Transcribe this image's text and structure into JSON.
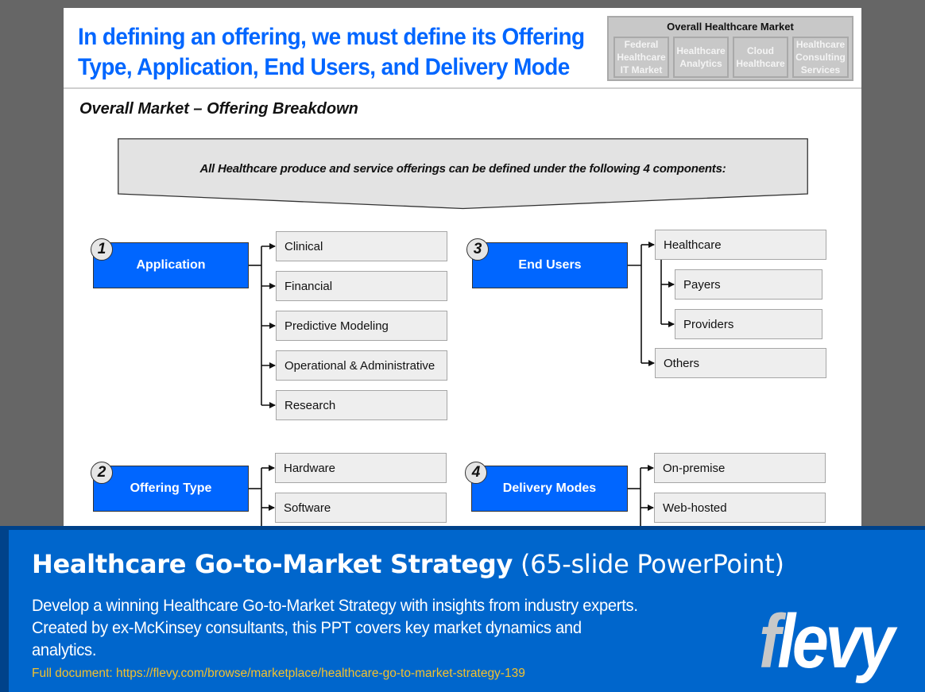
{
  "slide": {
    "title_lines": [
      "In defining an offering, we must define its Offering",
      "Type, Application, End Users, and Delivery Mode"
    ],
    "market_box": {
      "title": "Overall Healthcare Market",
      "items": [
        {
          "lines": [
            "Federal",
            "Healthcare",
            "IT Market"
          ]
        },
        {
          "lines": [
            "Healthcare",
            "Analytics"
          ]
        },
        {
          "lines": [
            "Cloud",
            "Healthcare"
          ]
        },
        {
          "lines": [
            "Healthcare",
            "Consulting",
            "Services"
          ]
        }
      ]
    },
    "subtitle": "Overall Market – Offering Breakdown",
    "banner_text": "All Healthcare produce and service offerings can be defined under the following 4 components:",
    "components": [
      {
        "number": "1",
        "label": "Application",
        "items": [
          "Clinical",
          "Financial",
          "Predictive Modeling",
          "Operational & Administrative",
          "Research"
        ]
      },
      {
        "number": "2",
        "label": "Offering Type",
        "items": [
          "Hardware",
          "Software"
        ]
      },
      {
        "number": "3",
        "label": "End Users",
        "items": [
          "Healthcare",
          "Payers",
          "Providers",
          "Others"
        ]
      },
      {
        "number": "4",
        "label": "Delivery Modes",
        "items": [
          "On-premise",
          "Web-hosted"
        ]
      }
    ]
  },
  "footer": {
    "title_bold": "Healthcare Go-to-Market Strategy",
    "title_light": " (65-slide PowerPoint)",
    "description": "Develop a winning Healthcare Go-to-Market Strategy with insights from industry experts. Created by ex-McKinsey consultants, this PPT covers key market dynamics and analytics.",
    "link_text": "Full document: https://flevy.com/browse/marketplace/healthcare-go-to-market-strategy-139",
    "logo_f": "f",
    "logo_rest": "levy",
    "colors": {
      "banner": "#0066cc",
      "frame": "#00428a",
      "link": "#f2c12e",
      "slide_title": "#0066ff"
    }
  }
}
